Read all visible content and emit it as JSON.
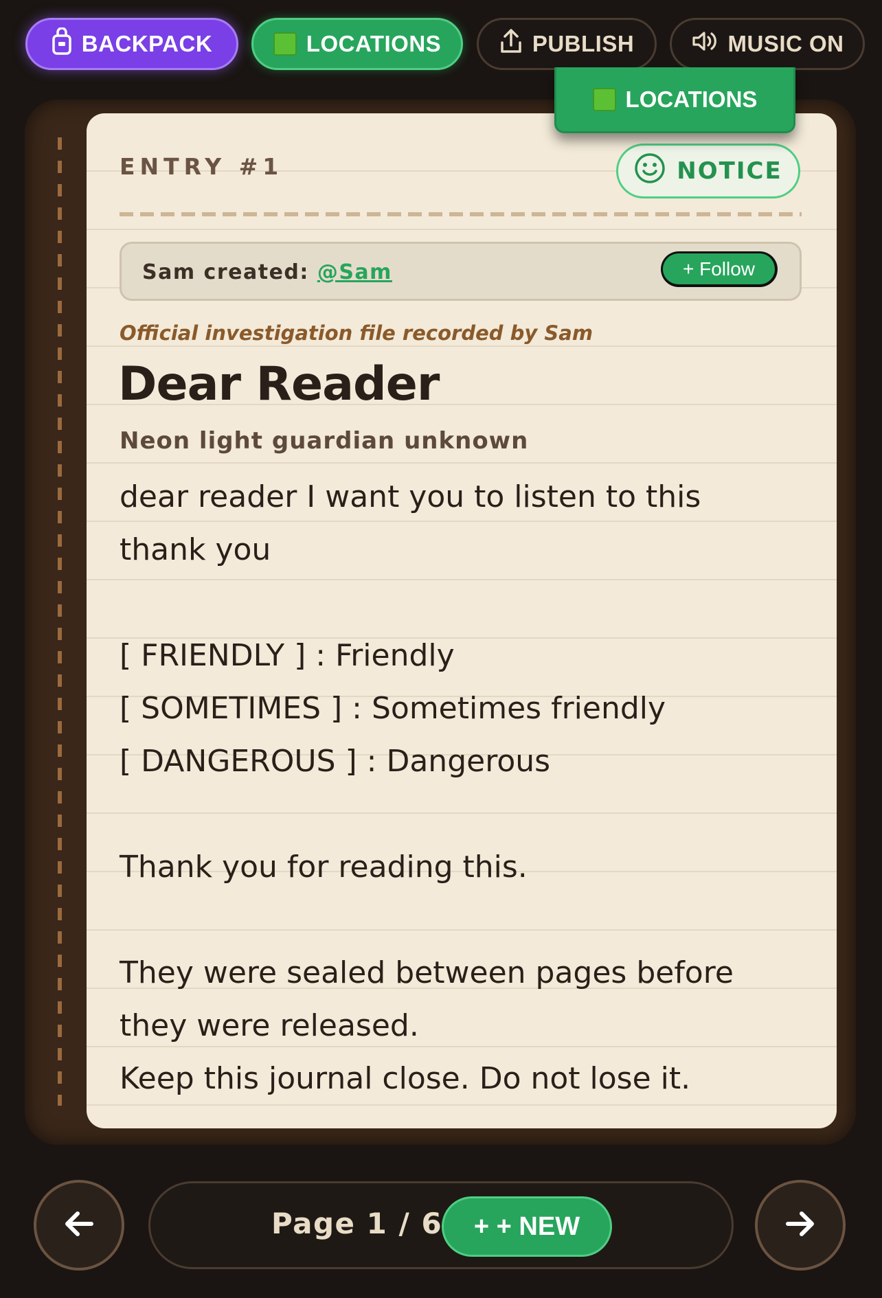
{
  "toolbar": {
    "backpack_label": "BACKPACK",
    "locations_label": "LOCATIONS",
    "publish_label": "PUBLISH",
    "music_label": "MUSIC ON"
  },
  "dropdown": {
    "locations_label": "LOCATIONS"
  },
  "entry": {
    "label": "ENTRY #1",
    "notice_label": "NOTICE",
    "creator_prefix": "Sam created: ",
    "creator_handle": "@Sam",
    "follow_label": "+ Follow",
    "subline": "Official investigation file recorded by Sam",
    "title": "Dear Reader",
    "subtitle": "Neon light guardian unknown",
    "body_lines": [
      "dear reader I want you to listen to this",
      "thank you",
      "",
      "[ FRIENDLY ] : Friendly",
      "[ SOMETIMES ] : Sometimes friendly",
      "[ DANGEROUS ] : Dangerous",
      "",
      "Thank you for reading this.",
      "",
      "They were sealed between pages before",
      "they were released.",
      "Keep this journal close. Do not lose it."
    ]
  },
  "pager": {
    "page_text": "Page 1 / 6",
    "new_label": "+ + NEW"
  },
  "colors": {
    "accent_purple": "#7a3fe6",
    "accent_green": "#27a55c",
    "paper": "#f3ead9",
    "book_cover": "#3a2719"
  },
  "icons": [
    "backpack-icon",
    "green-square-icon",
    "upload-icon",
    "speaker-icon",
    "smiley-icon",
    "arrow-left-icon",
    "arrow-right-icon"
  ]
}
